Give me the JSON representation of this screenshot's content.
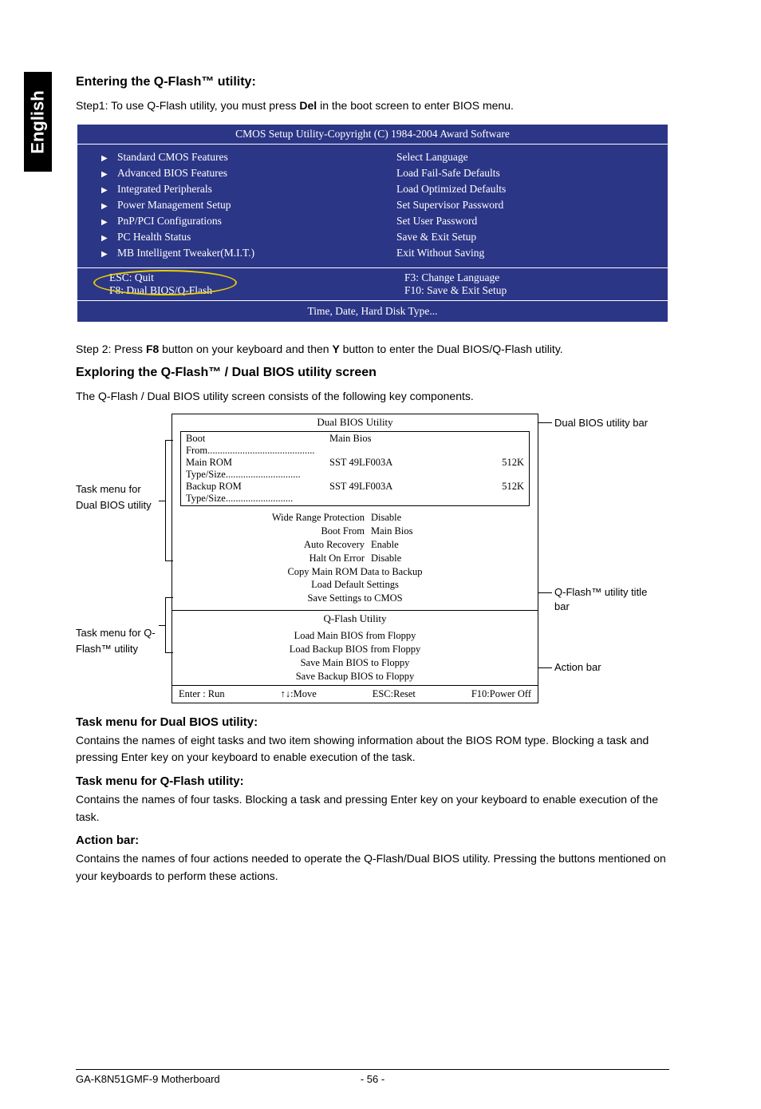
{
  "lang_tab": "English",
  "heading1": "Entering the Q-Flash™ utility:",
  "step1_pre": "Step1: To use Q-Flash utility, you must press ",
  "step1_bold": "Del",
  "step1_post": " in the boot screen to enter BIOS menu.",
  "bios": {
    "title": "CMOS Setup Utility-Copyright (C) 1984-2004 Award Software",
    "left": [
      "Standard CMOS Features",
      "Advanced BIOS Features",
      "Integrated Peripherals",
      "Power Management Setup",
      "PnP/PCI Configurations",
      "PC Health Status",
      "MB Intelligent Tweaker(M.I.T.)"
    ],
    "right": [
      "Select Language",
      "Load Fail-Safe Defaults",
      "Load Optimized Defaults",
      "Set Supervisor Password",
      "Set User Password",
      "Save & Exit Setup",
      "Exit Without Saving"
    ],
    "foot_left1": "ESC: Quit",
    "foot_left2": "F8: Dual BIOS/Q-Flash",
    "foot_right1": "F3: Change Language",
    "foot_right2": "F10: Save & Exit Setup",
    "foot_bottom": "Time, Date, Hard Disk Type..."
  },
  "step2_pre": "Step 2: Press ",
  "step2_b1": "F8",
  "step2_mid": " button on your keyboard and then ",
  "step2_b2": "Y",
  "step2_post": " button to enter the Dual BIOS/Q-Flash utility.",
  "heading2": "Exploring the Q-Flash™ / Dual BIOS utility screen",
  "intro2": "The Q-Flash / Dual BIOS utility screen consists of the following key components.",
  "dual": {
    "title": "Dual BIOS Utility",
    "boot_label": "Boot From",
    "boot_value": "Main Bios",
    "rom1_l": "Main ROM Type/Size",
    "rom1_v": "SST 49LF003A",
    "rom1_s": "512K",
    "rom2_l": "Backup ROM Type/Size",
    "rom2_v": "SST 49LF003A",
    "rom2_s": "512K",
    "menu": [
      {
        "l": "Wide Range Protection",
        "r": "Disable"
      },
      {
        "l": "Boot From",
        "r": "Main Bios"
      },
      {
        "l": "Auto Recovery",
        "r": "Enable"
      },
      {
        "l": "Halt On Error",
        "r": "Disable"
      }
    ],
    "menu_single": [
      "Copy Main ROM Data to Backup",
      "Load Default Settings",
      "Save Settings to CMOS"
    ],
    "qtitle": "Q-Flash Utility",
    "qmenu": [
      "Load Main BIOS from Floppy",
      "Load Backup BIOS from Floppy",
      "Save Main BIOS to Floppy",
      "Save Backup BIOS to Floppy"
    ],
    "action": [
      "Enter : Run",
      "↑↓:Move",
      "ESC:Reset",
      "F10:Power Off"
    ]
  },
  "labels": {
    "left1": "Task menu for Dual BIOS utility",
    "left2": "Task menu for Q-Flash™ utility",
    "right1": "Dual BIOS utility bar",
    "right2": "Q-Flash™ utility title bar",
    "right3": "Action bar"
  },
  "sub1_h": "Task menu for Dual BIOS utility:",
  "sub1_p": "Contains the names of eight tasks and two item showing information about the BIOS ROM type. Blocking a task and pressing Enter key on your keyboard to enable execution of the task.",
  "sub2_h": "Task menu for Q-Flash utility:",
  "sub2_p": "Contains the names of four tasks. Blocking a task and pressing Enter key on your keyboard to enable execution of the task.",
  "sub3_h": "Action bar:",
  "sub3_p": "Contains the names of four actions needed to operate the Q-Flash/Dual BIOS utility. Pressing the buttons mentioned on your keyboards to perform these actions.",
  "footer": {
    "left": "GA-K8N51GMF-9 Motherboard",
    "page": "- 56 -"
  }
}
